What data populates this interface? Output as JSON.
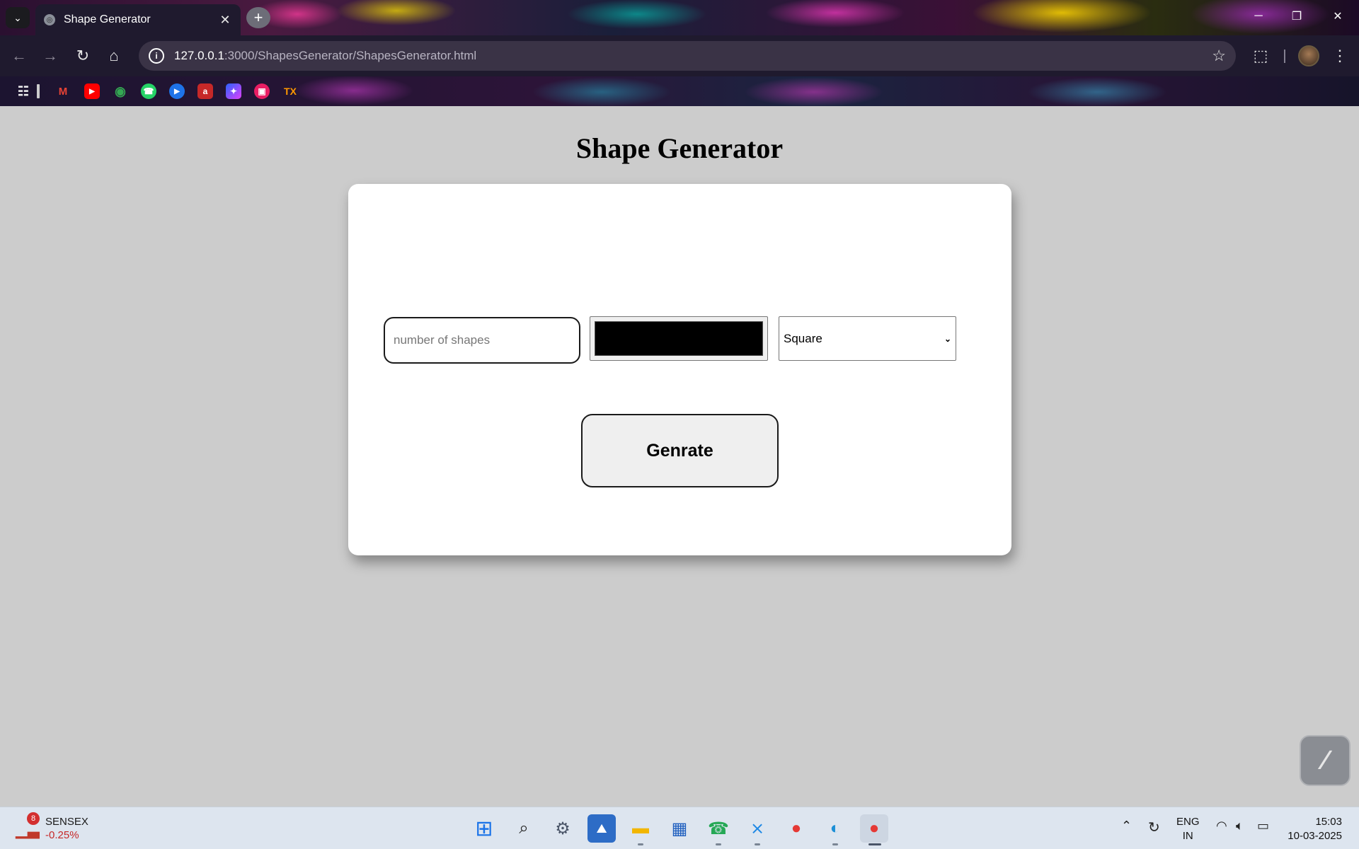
{
  "browser": {
    "tab_title": "Shape Generator",
    "url_host": "127.0.0.1",
    "url_path": ":3000/ShapesGenerator/ShapesGenerator.html",
    "bookmark_text": "TX"
  },
  "page": {
    "title": "Shape Generator",
    "shapes_input": {
      "placeholder": "number of shapes",
      "value": ""
    },
    "color_value": "#000000",
    "shape_select": {
      "selected": "Square"
    },
    "generate_label": "Genrate"
  },
  "taskbar": {
    "news_badge": "8",
    "news_name": "SENSEX",
    "news_change": "-0.25%",
    "lang_1": "ENG",
    "lang_2": "IN",
    "time": "15:03",
    "date": "10-03-2025"
  }
}
